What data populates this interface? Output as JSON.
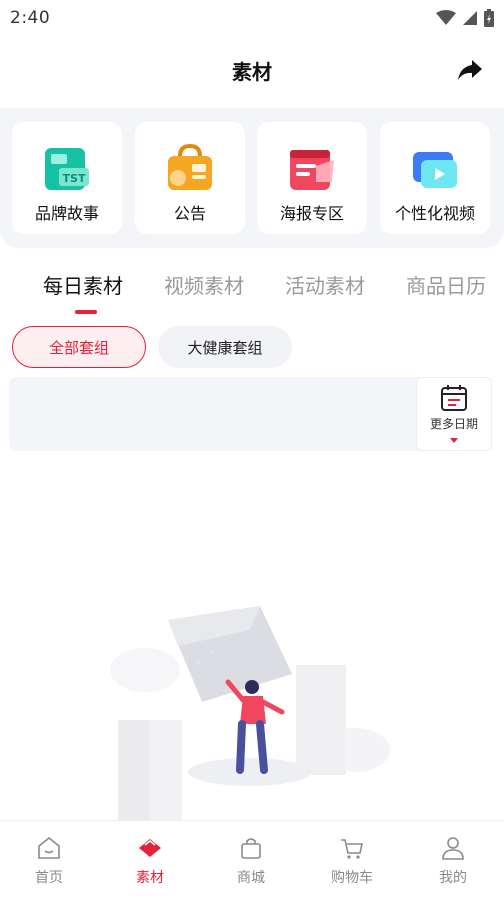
{
  "status_bar": {
    "time": "2:40"
  },
  "header": {
    "title": "素材"
  },
  "categories": [
    {
      "label": "品牌故事",
      "icon": "brand-story-icon"
    },
    {
      "label": "公告",
      "icon": "announcement-icon"
    },
    {
      "label": "海报专区",
      "icon": "poster-icon"
    },
    {
      "label": "个性化视频",
      "icon": "video-icon"
    }
  ],
  "tabs": [
    {
      "label": "每日素材",
      "active": true
    },
    {
      "label": "视频素材",
      "active": false
    },
    {
      "label": "活动素材",
      "active": false
    },
    {
      "label": "商品日历",
      "active": false
    }
  ],
  "filters": [
    {
      "label": "全部套组",
      "selected": true
    },
    {
      "label": "大健康套组",
      "selected": false
    }
  ],
  "date_strip": {
    "more_label": "更多日期"
  },
  "bottom_nav": [
    {
      "label": "首页",
      "icon": "home-icon",
      "active": false
    },
    {
      "label": "素材",
      "icon": "material-icon",
      "active": true
    },
    {
      "label": "商城",
      "icon": "shop-bag-icon",
      "active": false
    },
    {
      "label": "购物车",
      "icon": "cart-icon",
      "active": false
    },
    {
      "label": "我的",
      "icon": "profile-icon",
      "active": false
    }
  ],
  "colors": {
    "accent": "#e5223a",
    "panel_bg": "#f4f5f9",
    "inactive_text": "#9a9a9a"
  }
}
